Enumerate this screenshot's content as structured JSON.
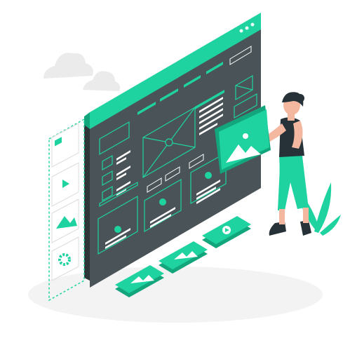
{
  "illustration": {
    "subject": "isometric-website-wireframe",
    "palette": {
      "accent": "#1ED3A0",
      "accent_dark": "#13A67D",
      "board": "#4A5458",
      "board_dark": "#3A4246",
      "cloud": "#EBEBEB",
      "shadow": "#F0F0F0",
      "skin": "#F4B8A0",
      "hair": "#263238",
      "outline": "#263238"
    },
    "icons": [
      "image-icon",
      "play-icon",
      "settings-icon",
      "document-icon"
    ]
  }
}
